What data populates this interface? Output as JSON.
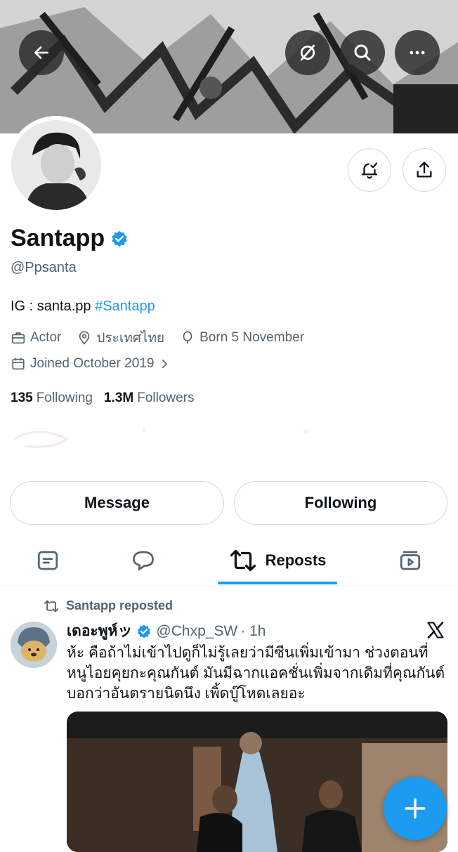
{
  "colors": {
    "accent": "#1d9bf0",
    "text_primary": "#0f1419",
    "text_secondary": "#536471",
    "border": "#cfd9de"
  },
  "header": {
    "back_icon": "arrow-left-icon",
    "grok_icon": "slashed-circle-icon",
    "search_icon": "search-icon",
    "more_icon": "more-horizontal-icon"
  },
  "profile": {
    "name": "Santapp",
    "handle": "@Ppsanta",
    "bio_prefix": "IG : santa.pp ",
    "bio_hashtag": "#Santapp",
    "category": "Actor",
    "location": "ประเทศไทย",
    "birthday": "Born 5 November",
    "joined": "Joined October 2019",
    "following_count": "135",
    "following_label": "Following",
    "followers_count": "1.3M",
    "followers_label": "Followers",
    "notify_icon": "bell-check-icon",
    "share_icon": "share-icon"
  },
  "actions": {
    "message_label": "Message",
    "following_label": "Following"
  },
  "tabs": [
    {
      "icon": "posts-icon",
      "label": ""
    },
    {
      "icon": "replies-icon",
      "label": ""
    },
    {
      "icon": "repost-icon",
      "label": "Reposts",
      "active": true
    },
    {
      "icon": "videos-icon",
      "label": ""
    }
  ],
  "post": {
    "repost_label": "Santapp reposted",
    "author_name": "เดอะพูห์ッ",
    "author_handle": "@Chxp_SW",
    "time": "· 1h",
    "text": "ห้ะ คือถ้าไม่เข้าไปดูก็ไม่รู้เลยว่ามีซีนเพิ่มเข้ามา ช่วงตอนที่หนูไอยคุยกะคุณกันต์ มันมีฉากแอคชั่นเพิ่มจากเดิมที่คุณกันต์บอกว่าอันตรายนิดนึง เพิ้ดบู๊โหดเลยอะ",
    "source_icon": "x-logo-icon"
  },
  "fab": {
    "icon": "plus-icon"
  }
}
